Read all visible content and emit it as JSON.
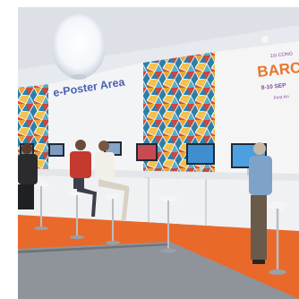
{
  "scene": {
    "area_sign": "e-Poster Area",
    "banner_line1": "1st CONG",
    "banner_brand": "BARC",
    "banner_dates": "8-10 SEP",
    "banner_subtitle": "First An"
  },
  "colors": {
    "floor_orange": "#e9692a",
    "wall_white": "#eef0f2",
    "sign_blue": "#4a5fb0",
    "brand_orange": "#e8762c",
    "brand_purple": "#7d4e9f"
  }
}
